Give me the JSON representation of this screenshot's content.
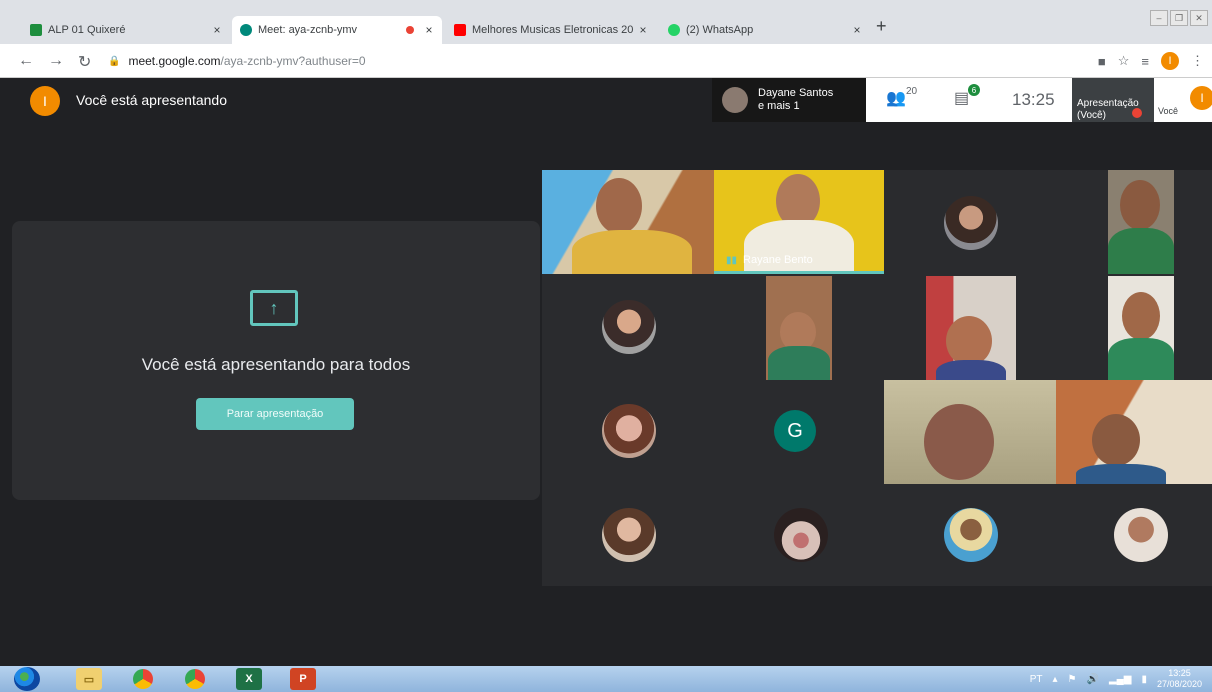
{
  "browser": {
    "tabs": [
      {
        "title": "ALP 01 Quixeré",
        "active": false,
        "favicon_color": "#1e8e3e"
      },
      {
        "title": "Meet: aya-zcnb-ymv",
        "active": true,
        "favicon_color": "#00897b",
        "recording": true
      },
      {
        "title": "Melhores Musicas Eletronicas 20",
        "active": false,
        "favicon_color": "#ff0000"
      },
      {
        "title": "(2) WhatsApp",
        "active": false,
        "favicon_color": "#25d366"
      }
    ],
    "close_glyph": "×",
    "new_tab_glyph": "+",
    "url_host": "meet.google.com",
    "url_path": "/aya-zcnb-ymv?authuser=0",
    "profile_initial": "I"
  },
  "meet": {
    "user_initial": "I",
    "presenting_header": "Você está apresentando",
    "participant_thumb_name": "Dayane Santos\ne mais 1",
    "participants_count": "20",
    "chat_badge": "6",
    "time": "13:25",
    "presentation_label": "Apresentação\n(Você)",
    "you_label": "Você",
    "presenting_to_all": "Você está apresentando para todos",
    "stop_button": "Parar apresentação",
    "active_speaker_name": "Rayane Bento",
    "g_avatar_letter": "G",
    "accent_color": "#62c6bd"
  },
  "taskbar": {
    "apps": [
      "explorer",
      "chrome",
      "chrome",
      "excel",
      "powerpoint"
    ],
    "language": "PT",
    "time": "13:25",
    "date": "27/08/2020"
  }
}
